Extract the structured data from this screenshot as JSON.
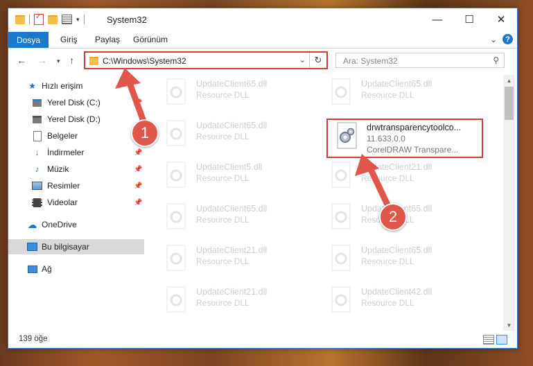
{
  "window": {
    "title": "System32",
    "controls": {
      "minimize": "—",
      "maximize": "☐",
      "close": "✕"
    }
  },
  "ribbon": {
    "tabs": [
      "Dosya",
      "Giriş",
      "Paylaş",
      "Görünüm"
    ],
    "expand_glyph": "⌄",
    "help_glyph": "?"
  },
  "address": {
    "path": "C:\\Windows\\System32",
    "search_placeholder": "Ara: System32"
  },
  "sidebar": {
    "items": [
      {
        "label": "Hızlı erişim",
        "icon": "star-icon"
      },
      {
        "label": "Yerel Disk (C:)",
        "icon": "drive-icon"
      },
      {
        "label": "Yerel Disk (D:)",
        "icon": "drive-icon"
      },
      {
        "label": "Belgeler",
        "icon": "documents-icon"
      },
      {
        "label": "İndirmeler",
        "icon": "download-icon"
      },
      {
        "label": "Müzik",
        "icon": "music-icon"
      },
      {
        "label": "Resimler",
        "icon": "pictures-icon"
      },
      {
        "label": "Videolar",
        "icon": "video-icon"
      },
      {
        "label": "OneDrive",
        "icon": "cloud-icon"
      },
      {
        "label": "Bu bilgisayar",
        "icon": "computer-icon"
      },
      {
        "label": "Ağ",
        "icon": "network-icon"
      }
    ]
  },
  "files": [
    {
      "name": "UpdateClient65.dll",
      "type": "Resource DLL"
    },
    {
      "name": "UpdateClient65.dll",
      "type": "Resource DLL"
    },
    {
      "name": "UpdateClient65.dll",
      "type": "Resource DLL"
    },
    {
      "name": "drwtransparencytoolco...",
      "version": "11.633.0.0",
      "type": "CorelDRAW Transpare..."
    },
    {
      "name": "UpdateClient5.dll",
      "type": "Resource DLL"
    },
    {
      "name": "UpdateClient21.dll",
      "type": "Resource DLL"
    },
    {
      "name": "UpdateClient65.dll",
      "type": "Resource DLL"
    },
    {
      "name": "UpdateClient65.dll",
      "type": "Resource DLL"
    },
    {
      "name": "UpdateClient21.dll",
      "type": "Resource DLL"
    },
    {
      "name": "UpdateClient65.dll",
      "type": "Resource DLL"
    },
    {
      "name": "UpdateClient21.dll",
      "type": "Resource DLL"
    },
    {
      "name": "UpdateClient42.dll",
      "type": "Resource DLL"
    }
  ],
  "status": {
    "count": "139 öğe"
  },
  "annotations": {
    "step1": "1",
    "step2": "2",
    "color": "#e0564b"
  }
}
